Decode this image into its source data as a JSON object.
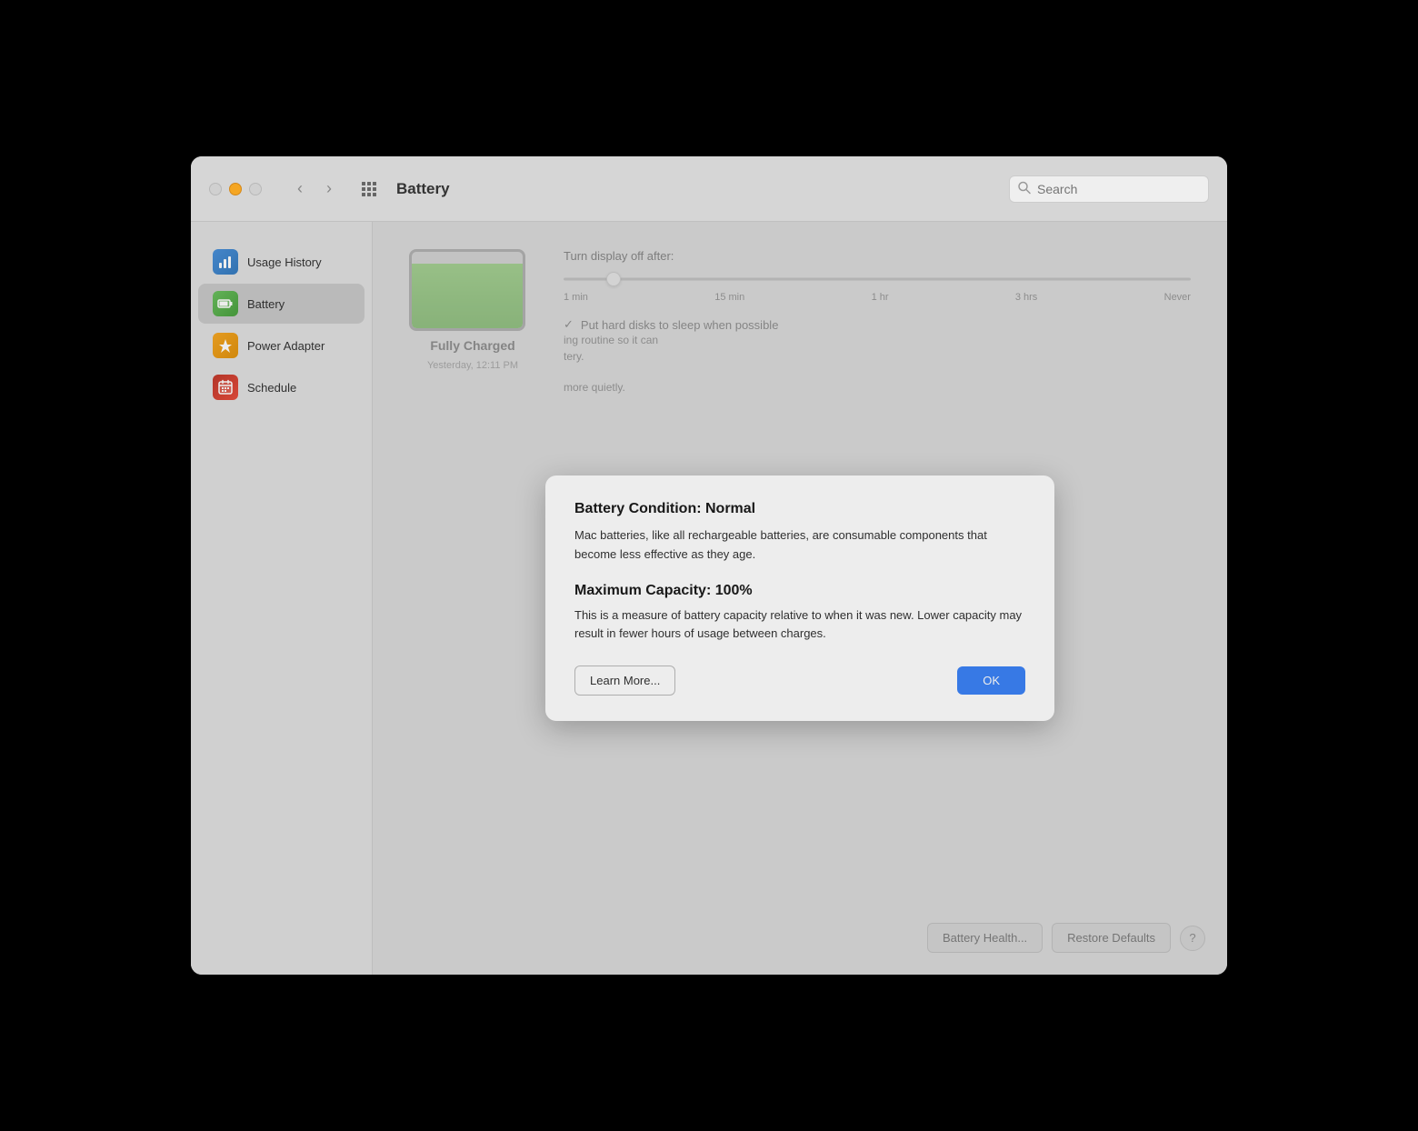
{
  "window": {
    "title": "Battery",
    "search_placeholder": "Search"
  },
  "traffic_lights": {
    "close": "close",
    "minimize": "minimize",
    "maximize": "maximize"
  },
  "nav": {
    "back": "‹",
    "forward": "›",
    "grid": "⊞"
  },
  "sidebar": {
    "items": [
      {
        "id": "usage-history",
        "label": "Usage History",
        "icon": "📊",
        "icon_type": "usage",
        "active": false
      },
      {
        "id": "battery",
        "label": "Battery",
        "icon": "🔋",
        "icon_type": "battery",
        "active": true
      },
      {
        "id": "power-adapter",
        "label": "Power Adapter",
        "icon": "⚡",
        "icon_type": "power",
        "active": false
      },
      {
        "id": "schedule",
        "label": "Schedule",
        "icon": "📅",
        "icon_type": "schedule",
        "active": false
      }
    ]
  },
  "main": {
    "display_off_label": "Turn display off after:",
    "slider_labels": [
      "1 min",
      "15 min",
      "1 hr",
      "3 hrs",
      "Never"
    ],
    "hard_disk_label": "Put hard disks to sleep when possible",
    "routine_text": "ing routine so it can\ntery.",
    "quietly_text": "more quietly.",
    "battery_status": "Fully Charged",
    "battery_time": "Yesterday, 12:11 PM",
    "buttons": {
      "battery_health": "Battery Health...",
      "restore_defaults": "Restore Defaults",
      "help": "?"
    }
  },
  "modal": {
    "title": "Battery Condition: Normal",
    "body1": "Mac batteries, like all rechargeable batteries, are consumable\ncomponents that become less effective as they age.",
    "section_title": "Maximum Capacity: 100%",
    "body2": "This is a measure of battery capacity relative to when it was new.\nLower capacity may result in fewer hours of usage between charges.",
    "learn_more_label": "Learn More...",
    "ok_label": "OK"
  }
}
